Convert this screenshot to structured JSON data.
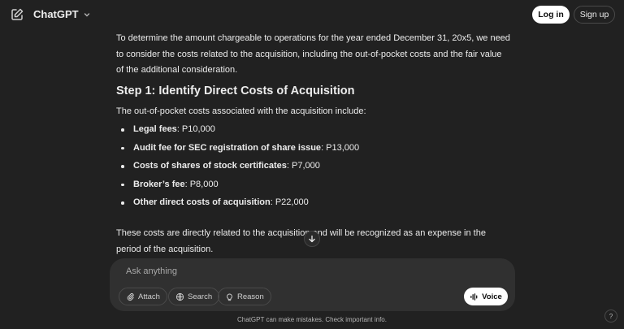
{
  "header": {
    "brand": "ChatGPT",
    "login_label": "Log in",
    "signup_label": "Sign up"
  },
  "message": {
    "paragraph1": "To determine the amount chargeable to operations for the year ended December 31, 20x5, we need to consider the costs related to the acquisition, including the out-of-pocket costs and the fair value of the additional consideration.",
    "heading": "Step 1: Identify Direct Costs of Acquisition",
    "intro": "The out-of-pocket costs associated with the acquisition include:",
    "items": [
      {
        "label": "Legal fees",
        "value": ": P10,000"
      },
      {
        "label": "Audit fee for SEC registration of share issue",
        "value": ": P13,000"
      },
      {
        "label": "Costs of shares of stock certificates",
        "value": ": P7,000"
      },
      {
        "label": "Broker’s fee",
        "value": ": P8,000"
      },
      {
        "label": "Other direct costs of acquisition",
        "value": ": P22,000"
      }
    ],
    "closing": "These costs are directly related to the acquisition and will be recognized as an expense in the period of the acquisition."
  },
  "composer": {
    "placeholder": "Ask anything",
    "attach_label": "Attach",
    "search_label": "Search",
    "reason_label": "Reason",
    "voice_label": "Voice"
  },
  "footer": {
    "disclaimer": "ChatGPT can make mistakes. Check important info.",
    "help_label": "?"
  },
  "icons": {
    "edit": "edit-icon",
    "chevron": "chevron-down-icon",
    "scroll": "arrow-down-icon",
    "attach": "paperclip-icon",
    "search": "globe-icon",
    "reason": "lightbulb-icon",
    "voice": "waveform-icon"
  }
}
